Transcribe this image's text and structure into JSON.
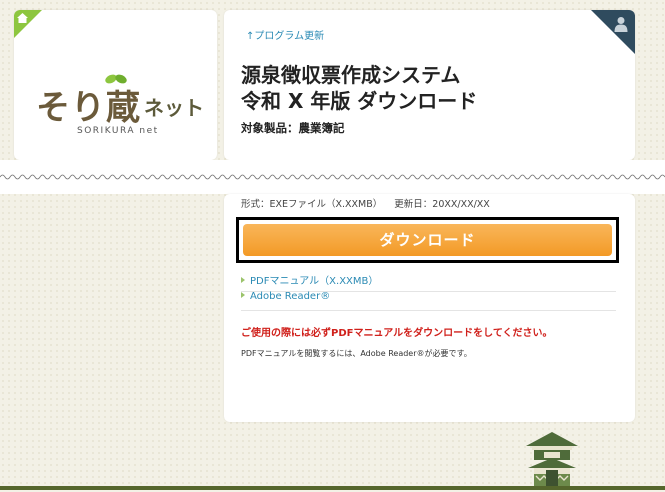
{
  "logo": {
    "main": "そり蔵",
    "net": "ネット",
    "sub": "SORIKURA net"
  },
  "header": {
    "update_link": "↑プログラム更新",
    "title": "源泉徴収票作成システム\n令和 X 年版 ダウンロード",
    "product": "対象製品：農業簿記"
  },
  "download": {
    "format": "形式：EXEファイル（X.XXMB）",
    "updated": "更新日：20XX/XX/XX",
    "button_label": "ダウンロード"
  },
  "links": [
    {
      "label": "PDFマニュアル（X.XXMB）"
    },
    {
      "label": "Adobe Reader®"
    }
  ],
  "notice": "ご使用の際には必ずPDFマニュアルをダウンロードをしてください。",
  "note": "PDFマニュアルを閲覧するには、Adobe Reader®が必要です。",
  "colors": {
    "accent_orange": "#f39a26",
    "link_blue": "#2a8ab4",
    "notice_red": "#d0201b",
    "home_green": "#8dc63f",
    "user_navy": "#2f4b5e"
  },
  "icons": {
    "home": "home-icon",
    "user": "user-icon",
    "building": "storehouse-icon"
  }
}
